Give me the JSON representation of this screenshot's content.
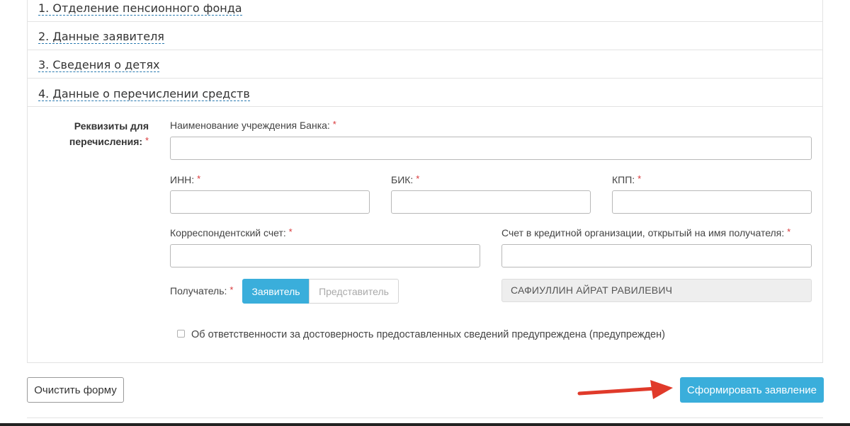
{
  "accordion": {
    "sections": [
      {
        "label": "1. Отделение пенсионного фонда"
      },
      {
        "label": "2. Данные заявителя"
      },
      {
        "label": "3. Сведения о детях"
      },
      {
        "label": "4. Данные о перечислении средств"
      }
    ]
  },
  "form": {
    "requisites_label_line1": "Реквизиты для",
    "requisites_label_line2": "перечисления:",
    "required_mark": "*",
    "bank_name_label": "Наименование учреждения Банка:",
    "bank_name_value": "",
    "inn_label": "ИНН:",
    "inn_value": "",
    "bik_label": "БИК:",
    "bik_value": "",
    "kpp_label": "КПП:",
    "kpp_value": "",
    "corr_account_label": "Корреспондентский счет:",
    "corr_account_value": "",
    "account_label": "Счет в кредитной организации, открытый на имя получателя:",
    "account_value": "",
    "recipient_label": "Получатель:",
    "recipient_options": [
      "Заявитель",
      "Представитель"
    ],
    "recipient_selected": "Заявитель",
    "recipient_name": "САФИУЛЛИН АЙРАТ РАВИЛЕВИЧ",
    "responsibility_label": "Об ответственности за достоверность предоставленных сведений предупреждена (предупрежден)",
    "responsibility_checked": false
  },
  "actions": {
    "clear_label": "Очистить форму",
    "submit_label": "Сформировать заявление"
  },
  "colors": {
    "accent": "#3aaedb",
    "required": "#d9383a",
    "arrow": "#e03a2a"
  }
}
